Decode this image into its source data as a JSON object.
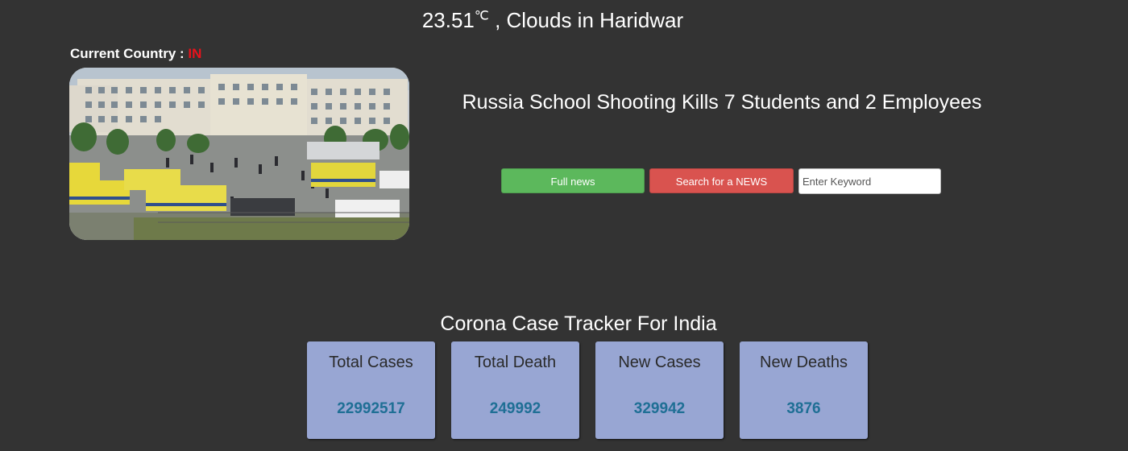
{
  "weather": {
    "temperature": "23.51",
    "unit": "℃",
    "description": " , Clouds in Haridwar"
  },
  "country": {
    "label": "Current Country : ",
    "code": "IN"
  },
  "news": {
    "headline": "Russia School Shooting Kills 7 Students and 2 Employees",
    "full_news_label": "Full news",
    "search_label": "Search for a NEWS",
    "keyword_placeholder": "Enter Keyword"
  },
  "tracker": {
    "title": "Corona Case Tracker For India",
    "cards": [
      {
        "label": "Total Cases",
        "value": "22992517"
      },
      {
        "label": "Total Death",
        "value": "249992"
      },
      {
        "label": "New Cases",
        "value": "329942"
      },
      {
        "label": "New Deaths",
        "value": "3876"
      }
    ]
  },
  "colors": {
    "background": "#333333",
    "country_code": "#e8121b",
    "full_news_button": "#5cb85c",
    "search_button": "#d9534f",
    "card_background": "#98a6d3",
    "card_value": "#1f6f95"
  }
}
